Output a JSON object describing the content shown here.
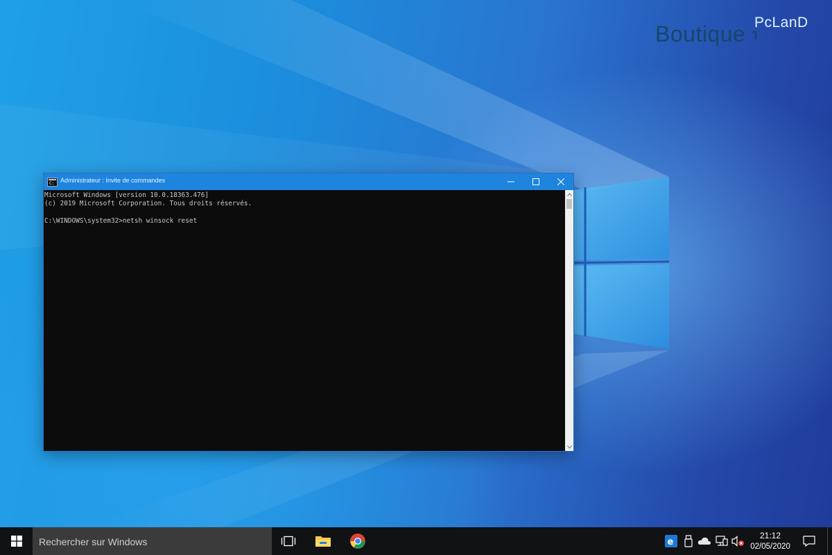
{
  "watermark": {
    "brand_main": "Boutique",
    "brand_sub": "PcLanD"
  },
  "cmd_window": {
    "title": "Administrateur : Invite de commandes",
    "icon": "console-icon",
    "buttons": {
      "minimize_icon": "minimize-icon",
      "maximize_icon": "maximize-icon",
      "close_icon": "close-icon"
    },
    "lines": [
      "Microsoft Windows [version 10.0.18363.476]",
      "(c) 2019 Microsoft Corporation. Tous droits réservés.",
      "",
      "C:\\WINDOWS\\system32>netsh winsock reset"
    ]
  },
  "taskbar": {
    "start_icon": "windows-start-icon",
    "search_placeholder": "Rechercher sur Windows",
    "pinned": [
      {
        "name": "task-view-icon"
      },
      {
        "name": "file-explorer-icon"
      },
      {
        "name": "chrome-icon"
      }
    ],
    "tray": [
      {
        "name": "edge-icon"
      },
      {
        "name": "usb-device-icon"
      },
      {
        "name": "onedrive-icon"
      },
      {
        "name": "network-icon"
      },
      {
        "name": "volume-muted-icon"
      }
    ],
    "clock": {
      "time": "21:12",
      "date": "02/05/2020"
    },
    "notification_icon": "action-center-icon"
  },
  "colors": {
    "titlebar": "#1e84de",
    "console_bg": "#0c0c0c",
    "console_text": "#c8c8c8",
    "taskbar": "#101214",
    "search_box": "#3b3b3b"
  }
}
